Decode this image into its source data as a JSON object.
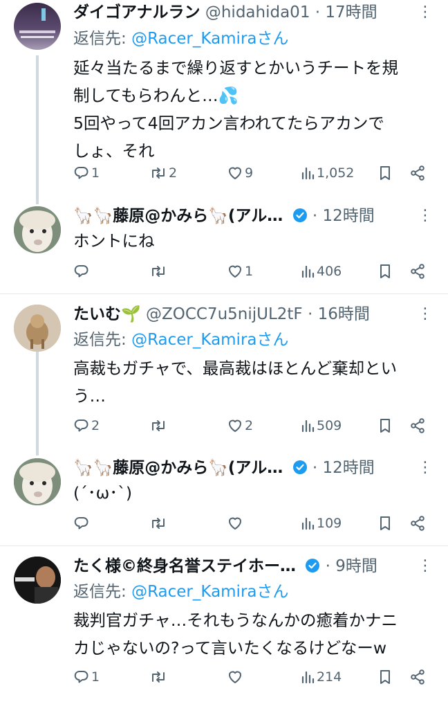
{
  "tweets": [
    {
      "name": "ダイゴアナルラン",
      "handle": "@hidahida01",
      "time": "17時間",
      "reply_label": "返信先: ",
      "reply_to": "@Racer_Kamiraさん",
      "text_lines": [
        "延々当たるまで繰り返すとかいうチートを規",
        "制してもらわんと…💦",
        "5回やって4回アカン言われてたらアカンで",
        "しょ、それ"
      ],
      "replies": "1",
      "retweets": "2",
      "likes": "9",
      "views": "1,052"
    },
    {
      "name": "🦙🦙藤原@かみら🦙(アル…",
      "time": "12時間",
      "text_lines": [
        "ホントにね"
      ],
      "replies": "",
      "retweets": "",
      "likes": "1",
      "views": "406"
    },
    {
      "name": "たいむ🌱",
      "handle": "@ZOCC7u5nijUL2tF",
      "time": "16時間",
      "reply_label": "返信先: ",
      "reply_to": "@Racer_Kamiraさん",
      "text_lines": [
        "高裁もガチャで、最高裁はほとんど棄却とい",
        "う…"
      ],
      "replies": "2",
      "retweets": "",
      "likes": "2",
      "views": "509"
    },
    {
      "name": "🦙🦙藤原@かみら🦙(アル…",
      "time": "12時間",
      "text_lines": [
        "(´･ω･`)"
      ],
      "replies": "",
      "retweets": "",
      "likes": "",
      "views": "109"
    },
    {
      "name": "たく様©終身名誉ステイホー…",
      "time": "9時間",
      "reply_label": "返信先: ",
      "reply_to": "@Racer_Kamiraさん",
      "text_lines": [
        "裁判官ガチャ…それもうなんかの癒着かナニ",
        "カじゃないの?って言いたくなるけどなーw"
      ],
      "replies": "1",
      "retweets": "",
      "likes": "",
      "views": "214"
    }
  ],
  "separator": "·",
  "more_icon": "⋮",
  "colors": {
    "text": "#0f1419",
    "secondary": "#536471",
    "accent": "#1d9bf0",
    "divider": "#e6e9ec",
    "thread": "#cfd9de"
  }
}
